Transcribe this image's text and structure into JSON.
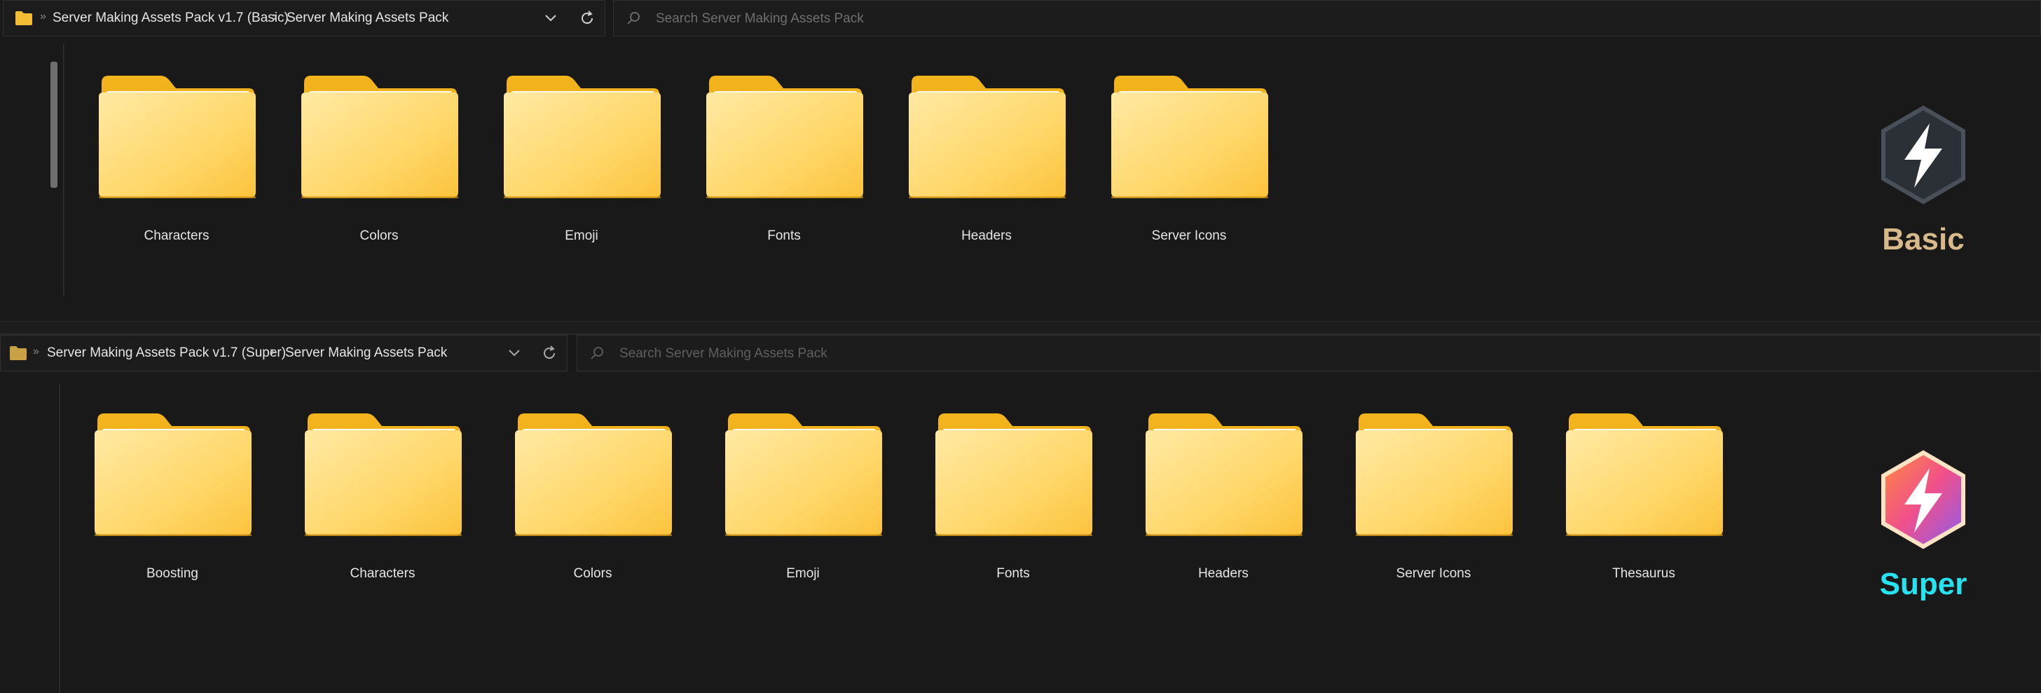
{
  "basic": {
    "breadcrumb": {
      "root": "Server Making Assets Pack v1.7 (Basic)",
      "child": "Server Making Assets Pack"
    },
    "search": {
      "placeholder": "Search Server Making Assets Pack"
    },
    "folders": [
      "Characters",
      "Colors",
      "Emoji",
      "Fonts",
      "Headers",
      "Server Icons"
    ],
    "badge": {
      "title": "Basic",
      "color": "#d7b98a",
      "icon": "lightning-hexagon-icon"
    }
  },
  "super": {
    "breadcrumb": {
      "root": "Server Making Assets Pack v1.7 (Super)",
      "child": "Server Making Assets Pack"
    },
    "search": {
      "placeholder": "Search Server Making Assets Pack"
    },
    "folders": [
      "Boosting",
      "Characters",
      "Colors",
      "Emoji",
      "Fonts",
      "Headers",
      "Server Icons",
      "Thesaurus"
    ],
    "badge": {
      "title": "Super",
      "color": "#27e3ef",
      "icon": "lightning-hexagon-icon"
    }
  },
  "icons": {
    "breadcrumb_separator": "›",
    "dropdown": "chevron-down-icon",
    "refresh": "refresh-icon",
    "search": "search-icon",
    "folder": "folder-icon"
  }
}
